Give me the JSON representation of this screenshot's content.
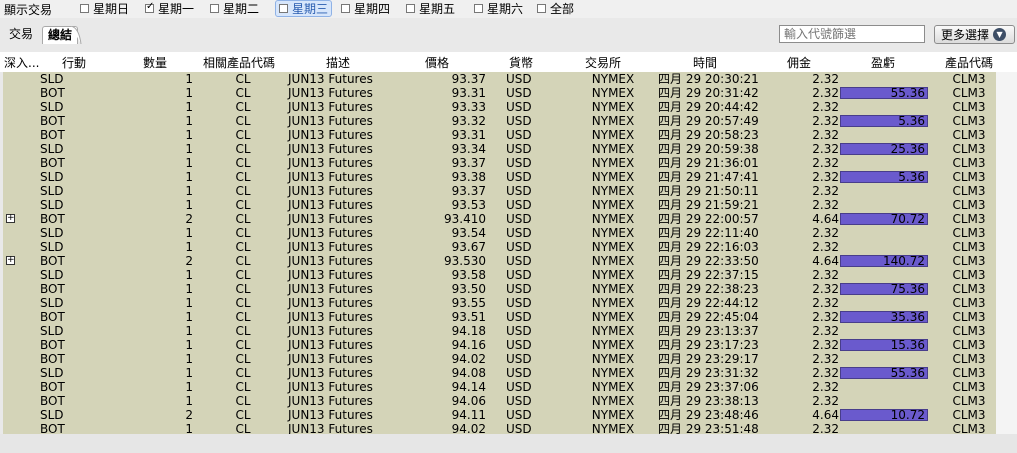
{
  "topbar": {
    "label": "顯示交易",
    "days": [
      {
        "label": "星期日",
        "checked": false,
        "selected": false
      },
      {
        "label": "星期一",
        "checked": true,
        "selected": false
      },
      {
        "label": "星期二",
        "checked": false,
        "selected": false
      },
      {
        "label": "星期三",
        "checked": false,
        "selected": true
      },
      {
        "label": "星期四",
        "checked": false,
        "selected": false
      },
      {
        "label": "星期五",
        "checked": false,
        "selected": false
      },
      {
        "label": "星期六",
        "checked": false,
        "selected": false
      },
      {
        "label": "全部",
        "checked": false,
        "selected": false
      }
    ]
  },
  "tabs": [
    {
      "label": "交易",
      "active": false
    },
    {
      "label": "總結",
      "active": true
    }
  ],
  "filter": {
    "placeholder": "輸入代號篩選"
  },
  "more_button": {
    "label": "更多選擇"
  },
  "columns": [
    "深入...",
    "行動",
    "數量",
    "相關產品代碼",
    "描述",
    "價格",
    "貨幣",
    "交易所",
    "時間",
    "佣金",
    "盈虧",
    "產品代碼"
  ],
  "colors": {
    "grid_bg": "#d4d4b8",
    "pnl_bar": "#6a5acd"
  },
  "rows": [
    {
      "expand": false,
      "action": "SLD",
      "qty": "1",
      "underlying": "CL",
      "desc": "JUN13 Futures",
      "price": "93.37",
      "currency": "USD",
      "exchange": "NYMEX",
      "time": "四月 29 20:30:21",
      "commission": "2.32",
      "pnl": "",
      "symbol": "CLM3"
    },
    {
      "expand": false,
      "action": "BOT",
      "qty": "1",
      "underlying": "CL",
      "desc": "JUN13 Futures",
      "price": "93.31",
      "currency": "USD",
      "exchange": "NYMEX",
      "time": "四月 29 20:31:42",
      "commission": "2.32",
      "pnl": "55.36",
      "symbol": "CLM3"
    },
    {
      "expand": false,
      "action": "SLD",
      "qty": "1",
      "underlying": "CL",
      "desc": "JUN13 Futures",
      "price": "93.33",
      "currency": "USD",
      "exchange": "NYMEX",
      "time": "四月 29 20:44:42",
      "commission": "2.32",
      "pnl": "",
      "symbol": "CLM3"
    },
    {
      "expand": false,
      "action": "BOT",
      "qty": "1",
      "underlying": "CL",
      "desc": "JUN13 Futures",
      "price": "93.32",
      "currency": "USD",
      "exchange": "NYMEX",
      "time": "四月 29 20:57:49",
      "commission": "2.32",
      "pnl": "5.36",
      "symbol": "CLM3"
    },
    {
      "expand": false,
      "action": "BOT",
      "qty": "1",
      "underlying": "CL",
      "desc": "JUN13 Futures",
      "price": "93.31",
      "currency": "USD",
      "exchange": "NYMEX",
      "time": "四月 29 20:58:23",
      "commission": "2.32",
      "pnl": "",
      "symbol": "CLM3"
    },
    {
      "expand": false,
      "action": "SLD",
      "qty": "1",
      "underlying": "CL",
      "desc": "JUN13 Futures",
      "price": "93.34",
      "currency": "USD",
      "exchange": "NYMEX",
      "time": "四月 29 20:59:38",
      "commission": "2.32",
      "pnl": "25.36",
      "symbol": "CLM3"
    },
    {
      "expand": false,
      "action": "BOT",
      "qty": "1",
      "underlying": "CL",
      "desc": "JUN13 Futures",
      "price": "93.37",
      "currency": "USD",
      "exchange": "NYMEX",
      "time": "四月 29 21:36:01",
      "commission": "2.32",
      "pnl": "",
      "symbol": "CLM3"
    },
    {
      "expand": false,
      "action": "SLD",
      "qty": "1",
      "underlying": "CL",
      "desc": "JUN13 Futures",
      "price": "93.38",
      "currency": "USD",
      "exchange": "NYMEX",
      "time": "四月 29 21:47:41",
      "commission": "2.32",
      "pnl": "5.36",
      "symbol": "CLM3"
    },
    {
      "expand": false,
      "action": "SLD",
      "qty": "1",
      "underlying": "CL",
      "desc": "JUN13 Futures",
      "price": "93.37",
      "currency": "USD",
      "exchange": "NYMEX",
      "time": "四月 29 21:50:11",
      "commission": "2.32",
      "pnl": "",
      "symbol": "CLM3"
    },
    {
      "expand": false,
      "action": "SLD",
      "qty": "1",
      "underlying": "CL",
      "desc": "JUN13 Futures",
      "price": "93.53",
      "currency": "USD",
      "exchange": "NYMEX",
      "time": "四月 29 21:59:21",
      "commission": "2.32",
      "pnl": "",
      "symbol": "CLM3"
    },
    {
      "expand": true,
      "action": "BOT",
      "qty": "2",
      "underlying": "CL",
      "desc": "JUN13 Futures",
      "price": "93.410",
      "currency": "USD",
      "exchange": "NYMEX",
      "time": "四月 29 22:00:57",
      "commission": "4.64",
      "pnl": "70.72",
      "symbol": "CLM3"
    },
    {
      "expand": false,
      "action": "SLD",
      "qty": "1",
      "underlying": "CL",
      "desc": "JUN13 Futures",
      "price": "93.54",
      "currency": "USD",
      "exchange": "NYMEX",
      "time": "四月 29 22:11:40",
      "commission": "2.32",
      "pnl": "",
      "symbol": "CLM3"
    },
    {
      "expand": false,
      "action": "SLD",
      "qty": "1",
      "underlying": "CL",
      "desc": "JUN13 Futures",
      "price": "93.67",
      "currency": "USD",
      "exchange": "NYMEX",
      "time": "四月 29 22:16:03",
      "commission": "2.32",
      "pnl": "",
      "symbol": "CLM3"
    },
    {
      "expand": true,
      "action": "BOT",
      "qty": "2",
      "underlying": "CL",
      "desc": "JUN13 Futures",
      "price": "93.530",
      "currency": "USD",
      "exchange": "NYMEX",
      "time": "四月 29 22:33:50",
      "commission": "4.64",
      "pnl": "140.72",
      "symbol": "CLM3"
    },
    {
      "expand": false,
      "action": "SLD",
      "qty": "1",
      "underlying": "CL",
      "desc": "JUN13 Futures",
      "price": "93.58",
      "currency": "USD",
      "exchange": "NYMEX",
      "time": "四月 29 22:37:15",
      "commission": "2.32",
      "pnl": "",
      "symbol": "CLM3"
    },
    {
      "expand": false,
      "action": "BOT",
      "qty": "1",
      "underlying": "CL",
      "desc": "JUN13 Futures",
      "price": "93.50",
      "currency": "USD",
      "exchange": "NYMEX",
      "time": "四月 29 22:38:23",
      "commission": "2.32",
      "pnl": "75.36",
      "symbol": "CLM3"
    },
    {
      "expand": false,
      "action": "SLD",
      "qty": "1",
      "underlying": "CL",
      "desc": "JUN13 Futures",
      "price": "93.55",
      "currency": "USD",
      "exchange": "NYMEX",
      "time": "四月 29 22:44:12",
      "commission": "2.32",
      "pnl": "",
      "symbol": "CLM3"
    },
    {
      "expand": false,
      "action": "BOT",
      "qty": "1",
      "underlying": "CL",
      "desc": "JUN13 Futures",
      "price": "93.51",
      "currency": "USD",
      "exchange": "NYMEX",
      "time": "四月 29 22:45:04",
      "commission": "2.32",
      "pnl": "35.36",
      "symbol": "CLM3"
    },
    {
      "expand": false,
      "action": "SLD",
      "qty": "1",
      "underlying": "CL",
      "desc": "JUN13 Futures",
      "price": "94.18",
      "currency": "USD",
      "exchange": "NYMEX",
      "time": "四月 29 23:13:37",
      "commission": "2.32",
      "pnl": "",
      "symbol": "CLM3"
    },
    {
      "expand": false,
      "action": "BOT",
      "qty": "1",
      "underlying": "CL",
      "desc": "JUN13 Futures",
      "price": "94.16",
      "currency": "USD",
      "exchange": "NYMEX",
      "time": "四月 29 23:17:23",
      "commission": "2.32",
      "pnl": "15.36",
      "symbol": "CLM3"
    },
    {
      "expand": false,
      "action": "BOT",
      "qty": "1",
      "underlying": "CL",
      "desc": "JUN13 Futures",
      "price": "94.02",
      "currency": "USD",
      "exchange": "NYMEX",
      "time": "四月 29 23:29:17",
      "commission": "2.32",
      "pnl": "",
      "symbol": "CLM3"
    },
    {
      "expand": false,
      "action": "SLD",
      "qty": "1",
      "underlying": "CL",
      "desc": "JUN13 Futures",
      "price": "94.08",
      "currency": "USD",
      "exchange": "NYMEX",
      "time": "四月 29 23:31:32",
      "commission": "2.32",
      "pnl": "55.36",
      "symbol": "CLM3"
    },
    {
      "expand": false,
      "action": "BOT",
      "qty": "1",
      "underlying": "CL",
      "desc": "JUN13 Futures",
      "price": "94.14",
      "currency": "USD",
      "exchange": "NYMEX",
      "time": "四月 29 23:37:06",
      "commission": "2.32",
      "pnl": "",
      "symbol": "CLM3"
    },
    {
      "expand": false,
      "action": "BOT",
      "qty": "1",
      "underlying": "CL",
      "desc": "JUN13 Futures",
      "price": "94.06",
      "currency": "USD",
      "exchange": "NYMEX",
      "time": "四月 29 23:38:13",
      "commission": "2.32",
      "pnl": "",
      "symbol": "CLM3"
    },
    {
      "expand": false,
      "action": "SLD",
      "qty": "2",
      "underlying": "CL",
      "desc": "JUN13 Futures",
      "price": "94.11",
      "currency": "USD",
      "exchange": "NYMEX",
      "time": "四月 29 23:48:46",
      "commission": "4.64",
      "pnl": "10.72",
      "symbol": "CLM3"
    },
    {
      "expand": false,
      "action": "BOT",
      "qty": "1",
      "underlying": "CL",
      "desc": "JUN13 Futures",
      "price": "94.02",
      "currency": "USD",
      "exchange": "NYMEX",
      "time": "四月 29 23:51:48",
      "commission": "2.32",
      "pnl": "",
      "symbol": "CLM3"
    }
  ]
}
